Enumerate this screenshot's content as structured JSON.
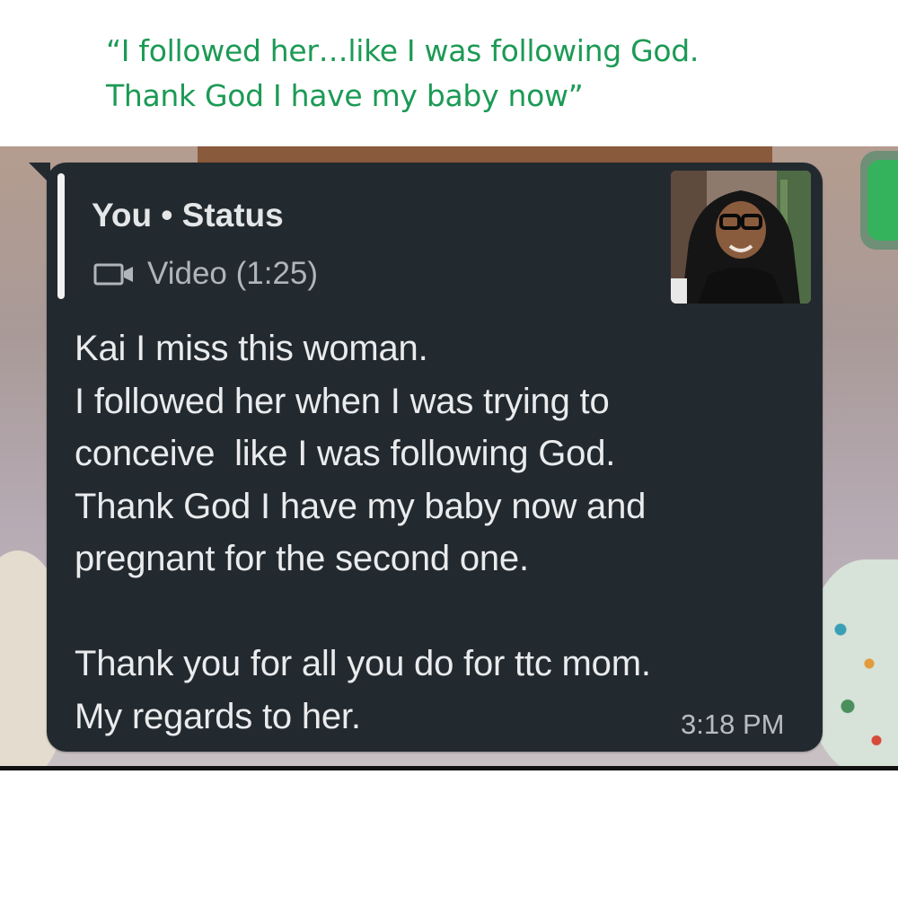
{
  "caption": {
    "line1": "“I followed her…like I was following God.",
    "line2": "Thank God I have my baby now”"
  },
  "chat": {
    "reply_quote": {
      "sender": "You • Status",
      "media_type_icon": "video-camera-icon",
      "media_label": "Video (1:25)"
    },
    "thumbnail_icon": "status-video-thumbnail",
    "message_lines": [
      "Kai I miss this woman.",
      "I followed her when I was trying to",
      "conceive  like I was following God.",
      "Thank God I have my baby now and",
      "pregnant for the second one.",
      "",
      "Thank you for all you do for ttc mom.",
      "My regards to her."
    ],
    "timestamp": "3:18 PM"
  },
  "colors": {
    "caption_green": "#1c9a55",
    "bubble_background": "#232a2f",
    "message_text": "#e9ebed",
    "meta_text": "#b0b5b9"
  }
}
